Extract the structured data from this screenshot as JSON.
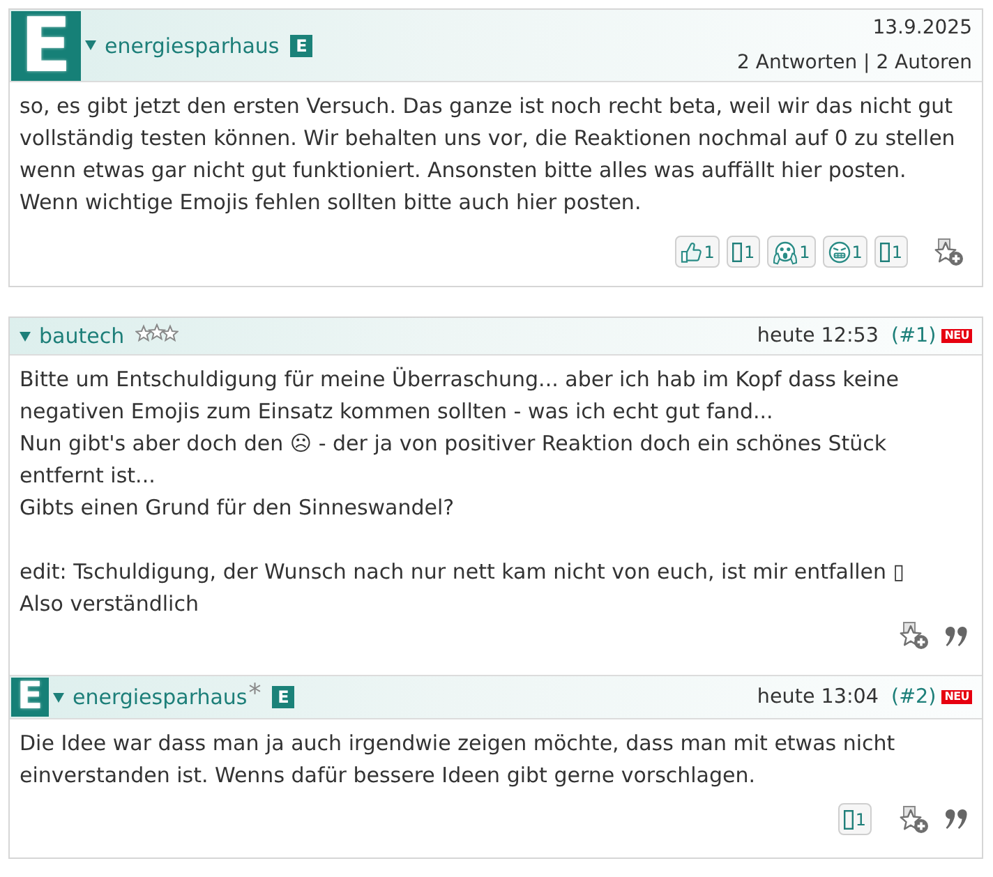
{
  "thread": {
    "author": {
      "kind": "team",
      "avatar": "E",
      "name": "energiesparhaus",
      "badge": "E"
    },
    "date": "13.9.2025",
    "stats": "2 Antworten | 2 Autoren",
    "body": "so, es gibt jetzt den ersten Versuch. Das ganze ist noch recht beta, weil wir das nicht gut\nvollständig testen können. Wir behalten uns vor, die Reaktionen nochmal auf 0 zu stellen\nwenn etwas gar nicht gut funktioniert. Ansonsten bitte alles was auffällt hier posten.\nWenn wichtige Emojis fehlen sollten bitte auch hier posten.",
    "reactions": [
      {
        "kind": "thumbs-up",
        "count": "1"
      },
      {
        "kind": "missing-glyph",
        "count": "1"
      },
      {
        "kind": "screaming-face",
        "count": "1"
      },
      {
        "kind": "grimacing-face",
        "count": "1"
      },
      {
        "kind": "missing-glyph",
        "count": "1"
      }
    ]
  },
  "replies": [
    {
      "author": {
        "kind": "member",
        "name": "bautech"
      },
      "time": "heute 12:53",
      "number": "(#1)",
      "new_badge": "NEU",
      "body": "Bitte um Entschuldigung für meine Überraschung... aber ich hab im Kopf dass keine\nnegativen Emojis zum Einsatz kommen sollten - was ich echt gut fand...\nNun gibt's aber doch den ☹ - der ja von positiver Reaktion doch ein schönes Stück\nentfernt ist...\nGibts einen Grund für den Sinneswandel?\n\nedit: Tschuldigung, der Wunsch nach nur nett kam nicht von euch, ist mir entfallen ▯\nAlso verständlich"
    },
    {
      "author": {
        "kind": "team",
        "avatar": "E",
        "name": "energiesparhaus",
        "mark": "*",
        "badge": "E"
      },
      "time": "heute 13:04",
      "number": "(#2)",
      "new_badge": "NEU",
      "body": "Die Idee war dass man ja auch irgendwie zeigen möchte, dass man mit etwas nicht\neinverstanden ist. Wenns dafür bessere Ideen gibt gerne vorschlagen.",
      "reactions": [
        {
          "kind": "missing-glyph",
          "count": "1"
        }
      ]
    }
  ]
}
